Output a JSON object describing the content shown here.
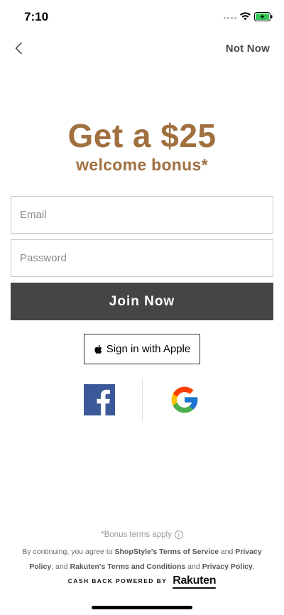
{
  "status_bar": {
    "time": "7:10"
  },
  "nav": {
    "back_icon": "chevron-left-icon",
    "not_now_label": "Not Now"
  },
  "promo": {
    "headline": "Get a $25",
    "subheadline": "welcome bonus*"
  },
  "form": {
    "email_placeholder": "Email",
    "email_value": "",
    "password_placeholder": "Password",
    "password_value": "",
    "join_label": "Join Now"
  },
  "social": {
    "apple_label": "Sign in with Apple",
    "apple_icon": "apple-icon",
    "facebook_icon": "facebook-icon",
    "google_icon": "google-icon"
  },
  "footer": {
    "bonus_terms": "*Bonus terms apply",
    "info_icon": "info-icon",
    "legal_prefix": "By continuing, you agree to ",
    "shopstyle_terms": "ShopStyle's Terms of Service",
    "and_1": " and ",
    "privacy_policy_1": "Privacy Policy",
    "comma_and": ", and ",
    "rakuten_terms": "Rakuten's Terms and Conditions",
    "and_2": " and ",
    "privacy_policy_2": "Privacy Policy",
    "period": ".",
    "cashback_text": "CASH BACK POWERED BY",
    "rakuten_logo": "Rakuten"
  },
  "colors": {
    "accent": "#a0703f",
    "join_button": "#444547",
    "facebook": "#3b5998"
  }
}
